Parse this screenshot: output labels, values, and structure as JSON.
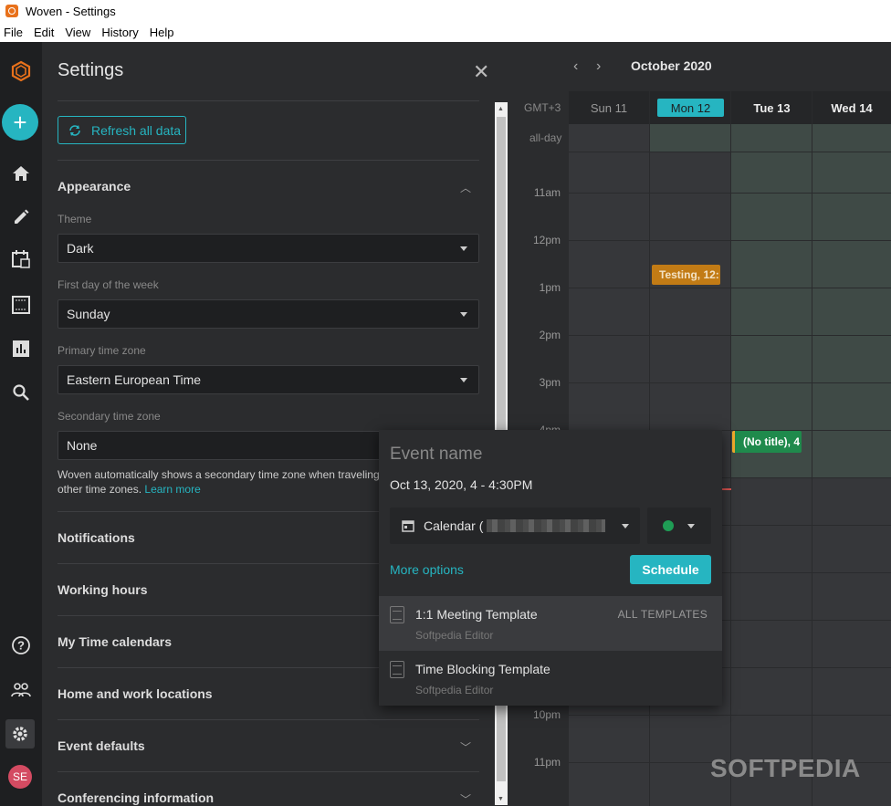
{
  "window": {
    "title": "Woven - Settings"
  },
  "menu": [
    "File",
    "Edit",
    "View",
    "History",
    "Help"
  ],
  "rail": {
    "avatar_initials": "SE",
    "icons": [
      "woven-logo-icon",
      "add-icon",
      "home-icon",
      "pencil-icon",
      "calendar-add-icon",
      "template-icon",
      "analytics-icon",
      "search-icon",
      "help-icon",
      "people-icon",
      "gear-icon"
    ]
  },
  "settings": {
    "title": "Settings",
    "refresh_label": "Refresh all data",
    "appearance": {
      "title": "Appearance",
      "theme_label": "Theme",
      "theme_value": "Dark",
      "first_day_label": "First day of the week",
      "first_day_value": "Sunday",
      "primary_tz_label": "Primary time zone",
      "primary_tz_value": "Eastern European Time",
      "secondary_tz_label": "Secondary time zone",
      "secondary_tz_value": "None",
      "help_text_line1": "Woven automatically shows a secondary time zone when traveling",
      "help_text_line2": "other time zones.",
      "learn_more": "Learn more"
    },
    "sections": [
      "Notifications",
      "Working hours",
      "My Time calendars",
      "Home and work locations",
      "Event defaults",
      "Conferencing information"
    ]
  },
  "calendar": {
    "month": "October 2020",
    "timezone": "GMT+3",
    "allday_label": "all-day",
    "days": [
      {
        "dow": "Sun",
        "num": "11"
      },
      {
        "dow": "Mon",
        "num": "12"
      },
      {
        "dow": "Tue",
        "num": "13"
      },
      {
        "dow": "Wed",
        "num": "14"
      }
    ],
    "times": [
      "11am",
      "12pm",
      "1pm",
      "2pm",
      "3pm",
      "4pm",
      "10pm",
      "11pm"
    ],
    "events": [
      {
        "title": "Testing, 12:",
        "color": "#c27b15"
      },
      {
        "title": "(No title), 4",
        "color": "#1f8a4c"
      }
    ],
    "accent": "#26b5c1"
  },
  "popup": {
    "event_name_placeholder": "Event name",
    "date": "Oct 13, 2020, 4 - 4:30PM",
    "calendar_label": "Calendar (",
    "more_options": "More options",
    "schedule_label": "Schedule",
    "all_templates": "ALL TEMPLATES",
    "templates": [
      {
        "title": "1:1 Meeting Template",
        "sub": "Softpedia Editor"
      },
      {
        "title": "Time Blocking Template",
        "sub": "Softpedia Editor"
      }
    ]
  },
  "watermark": "SOFTPEDIA"
}
